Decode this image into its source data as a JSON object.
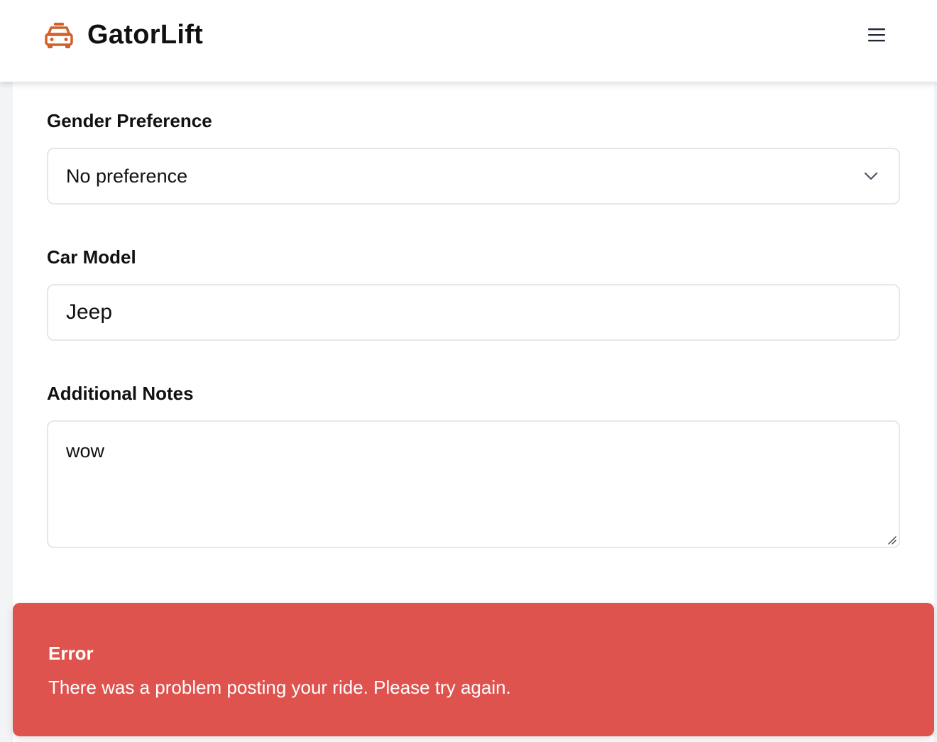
{
  "app": {
    "name": "GatorLift",
    "brand_icon": "taxi-icon",
    "menu_icon": "hamburger-menu-icon",
    "brand_color": "#d35f2a"
  },
  "form": {
    "gender_preference": {
      "label": "Gender Preference",
      "value": "No preference"
    },
    "car_model": {
      "label": "Car Model",
      "value": "Jeep"
    },
    "additional_notes": {
      "label": "Additional Notes",
      "value": "wow"
    }
  },
  "toast": {
    "title": "Error",
    "message": "There was a problem posting your ride. Please try again.",
    "color": "#df534f"
  }
}
